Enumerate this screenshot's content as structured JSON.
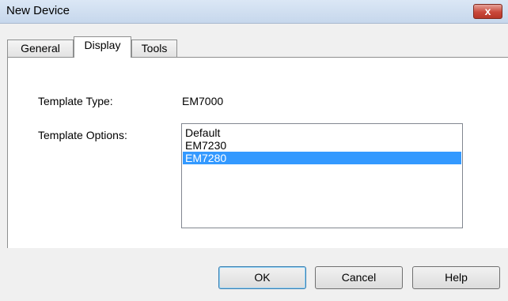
{
  "window": {
    "title": "New Device",
    "close_glyph": "x"
  },
  "tabs": [
    {
      "label": "General",
      "active": false
    },
    {
      "label": "Display",
      "active": true
    },
    {
      "label": "Tools",
      "active": false
    }
  ],
  "display": {
    "template_type_label": "Template Type:",
    "template_type_value": "EM7000",
    "template_options_label": "Template Options:",
    "template_options": [
      {
        "label": "Default",
        "selected": false
      },
      {
        "label": "EM7230",
        "selected": false
      },
      {
        "label": "EM7280",
        "selected": true
      }
    ]
  },
  "buttons": {
    "ok": "OK",
    "cancel": "Cancel",
    "help": "Help"
  },
  "colors": {
    "selection": "#3399ff",
    "close_button": "#c9483a"
  },
  "icons": {
    "close": "close-icon"
  }
}
